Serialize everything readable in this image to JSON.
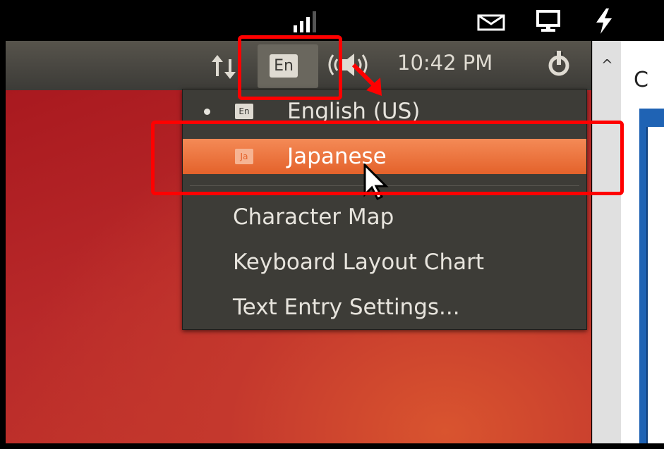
{
  "host_bar": {
    "icons": [
      "signal-icon",
      "mail-icon",
      "display-icon",
      "lightning-icon"
    ]
  },
  "panel": {
    "indicator_icons": [
      "network-icon",
      "volume-icon",
      "power-icon"
    ],
    "keyboard_indicator": "En",
    "clock": "10:42 PM"
  },
  "menu": {
    "items": [
      {
        "label": "English (US)",
        "badge": "En",
        "selected": true
      },
      {
        "label": "Japanese",
        "badge": "Ja",
        "highlighted": true
      },
      {
        "label": "Character Map"
      },
      {
        "label": "Keyboard Layout Chart"
      },
      {
        "label": "Text Entry Settings..."
      }
    ]
  },
  "right_window": {
    "partial_letter": "C"
  },
  "colors": {
    "annotation": "#ff0000",
    "highlight": "#e9692f",
    "menu_bg": "#3d3c37",
    "panel_bg": "#3c3b37"
  }
}
